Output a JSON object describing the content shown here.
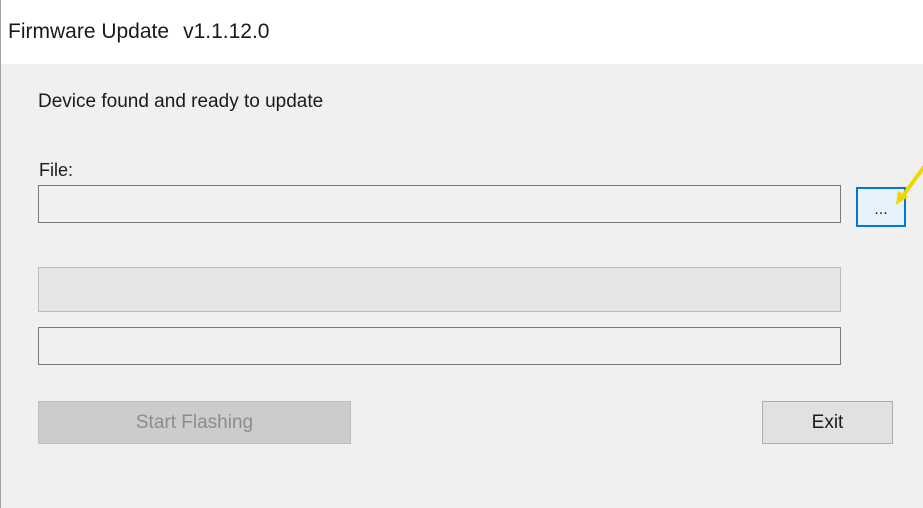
{
  "window": {
    "title": "Firmware Update",
    "version": "v1.1.12.0"
  },
  "status": {
    "message": "Device found and ready to update"
  },
  "file": {
    "label": "File:",
    "value": "",
    "browse_label": "..."
  },
  "progress": {
    "value": 0
  },
  "log": {
    "text": ""
  },
  "buttons": {
    "start_label": "Start Flashing",
    "start_enabled": false,
    "exit_label": "Exit"
  },
  "colors": {
    "focus_accent": "#0078d7",
    "annotation_arrow": "#f2d600"
  },
  "annotation": {
    "icon": "arrow-pointer-icon"
  }
}
